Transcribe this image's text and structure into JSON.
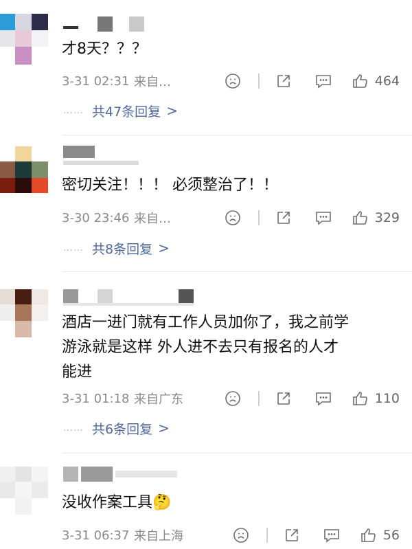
{
  "comments": [
    {
      "text": "才8天？？？",
      "time": "3-31 02:31",
      "source": "来自…",
      "likes": "464",
      "replies": "共47条回复"
    },
    {
      "text": "密切关注！！！ 必须整治了！！",
      "time": "3-30 23:46",
      "source": "来自…",
      "likes": "329",
      "replies": "共8条回复"
    },
    {
      "text_line1": "酒店一进门就有工作人员加你了，我之前学",
      "text_line2": "游泳就是这样 外人进不去只有报名的人才",
      "text_line3": "能进",
      "time": "3-31 01:18",
      "source": "来自广东",
      "likes": "110",
      "replies": "共6条回复"
    },
    {
      "text": "没收作案工具",
      "emoji": "🤔",
      "time": "3-31 06:37",
      "source": "来自上海",
      "likes": "56"
    }
  ],
  "ui": {
    "reply_dots": "……",
    "reply_chevron": ">",
    "icons": [
      "sad-face-icon",
      "share-icon",
      "comment-icon",
      "thumbs-up-icon"
    ],
    "link_color": "#4f6a9a"
  }
}
